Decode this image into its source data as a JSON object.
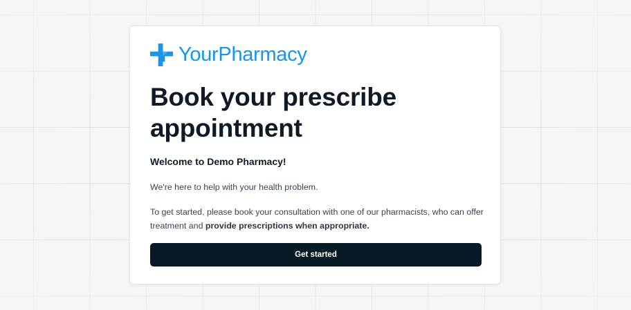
{
  "brand": {
    "name": "YourPharmacy",
    "icon": "medical-cross-icon",
    "color": "#1a94e6"
  },
  "card": {
    "title": "Book your prescribe appointment",
    "welcome": "Welcome to Demo Pharmacy!",
    "intro": "We're here to help with your health problem.",
    "body_prefix": "To get started, please book your consultation with one of our pharmacists, who can offer treatment and ",
    "body_bold": "provide prescriptions when appropriate.",
    "cta_label": "Get started"
  },
  "colors": {
    "heading": "#0e1b26",
    "button_bg": "#061a25",
    "body_text": "#3a4550"
  }
}
